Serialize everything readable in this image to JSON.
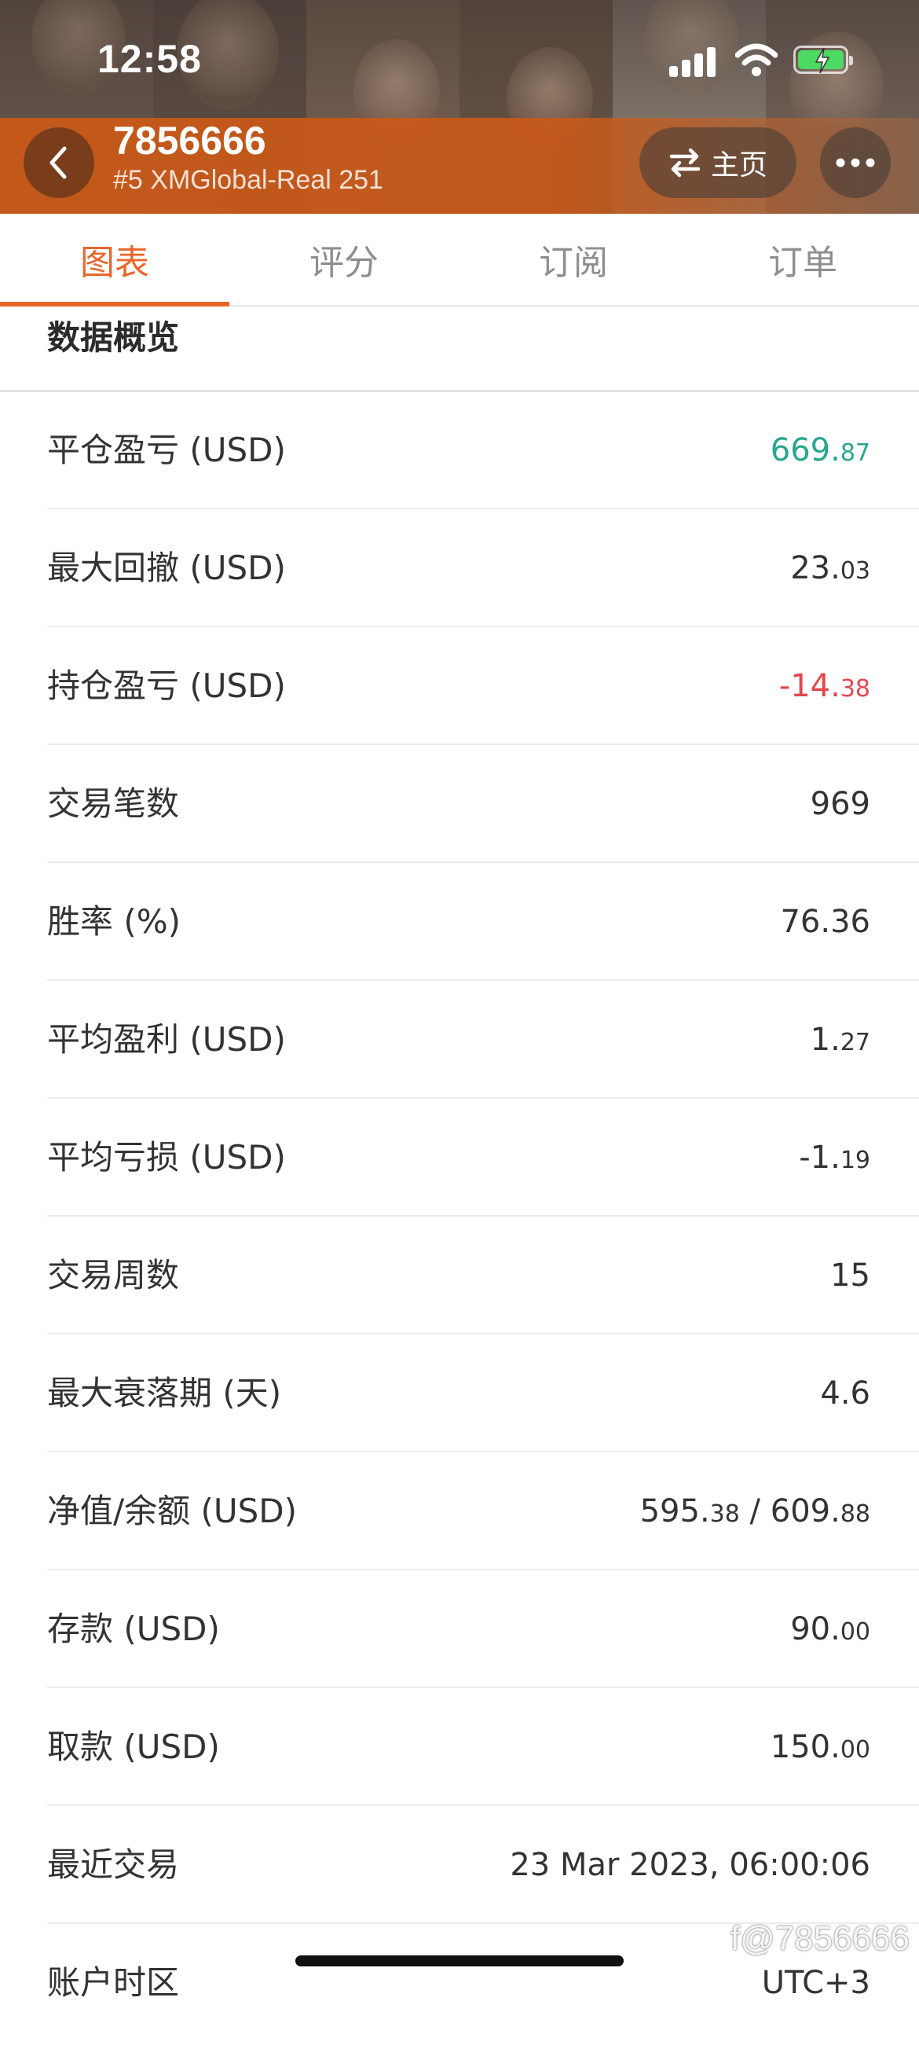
{
  "status_bar": {
    "time": "12:58"
  },
  "header": {
    "account_id": "7856666",
    "server": "#5 XMGlobal-Real 251",
    "home_label": "主页"
  },
  "tabs": [
    {
      "label": "图表",
      "active": true
    },
    {
      "label": "评分",
      "active": false
    },
    {
      "label": "订阅",
      "active": false
    },
    {
      "label": "订单",
      "active": false
    }
  ],
  "section": {
    "title": "数据概览"
  },
  "rows": [
    {
      "label": "平仓盈亏 (USD)",
      "int": "669.",
      "dec": "87",
      "tone": "green"
    },
    {
      "label": "最大回撤 (USD)",
      "int": "23.",
      "dec": "03",
      "tone": "normal"
    },
    {
      "label": "持仓盈亏 (USD)",
      "int": "-14.",
      "dec": "38",
      "tone": "red"
    },
    {
      "label": "交易笔数",
      "int": "969",
      "dec": "",
      "tone": "normal"
    },
    {
      "label": "胜率 (%)",
      "int": "76.36",
      "dec": "",
      "tone": "normal"
    },
    {
      "label": "平均盈利 (USD)",
      "int": "1.",
      "dec": "27",
      "tone": "normal"
    },
    {
      "label": "平均亏损 (USD)",
      "int": "-1.",
      "dec": "19",
      "tone": "normal"
    },
    {
      "label": "交易周数",
      "int": "15",
      "dec": "",
      "tone": "normal"
    },
    {
      "label": "最大衰落期 (天)",
      "int": "4.6",
      "dec": "",
      "tone": "normal"
    },
    {
      "label": "净值/余额 (USD)",
      "int": "595.",
      "dec": "38",
      "int2": " / 609.",
      "dec2": "88",
      "tone": "normal"
    },
    {
      "label": "存款 (USD)",
      "int": "90.",
      "dec": "00",
      "tone": "normal"
    },
    {
      "label": "取款 (USD)",
      "int": "150.",
      "dec": "00",
      "tone": "normal"
    },
    {
      "label": "最近交易",
      "int": "23 Mar 2023, 06:00:06",
      "dec": "",
      "tone": "normal"
    },
    {
      "label": "账户时区",
      "int": "UTC+3",
      "dec": "",
      "tone": "normal"
    }
  ],
  "watermark": "f@7856666",
  "colors": {
    "accent": "#e8662a",
    "positive": "#2aa58e",
    "negative": "#e2474f"
  }
}
